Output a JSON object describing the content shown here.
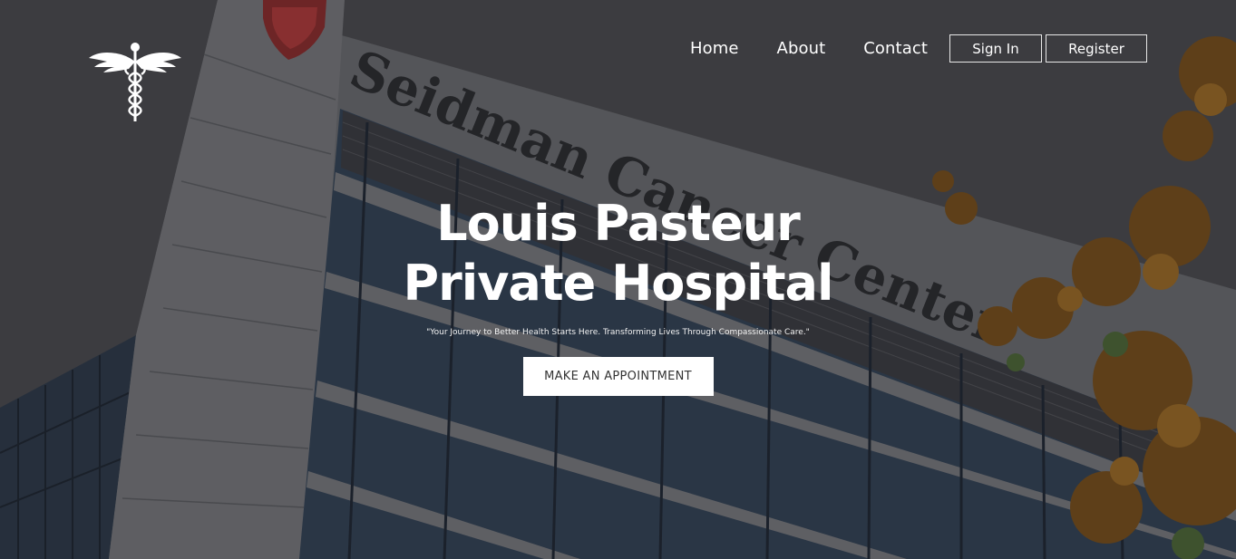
{
  "brand": {
    "logo_icon": "caduceus-icon"
  },
  "nav": {
    "home": "Home",
    "about": "About",
    "contact": "Contact",
    "sign_in": "Sign In",
    "register": "Register"
  },
  "hero": {
    "title_line1": "Louis Pasteur",
    "title_line2": "Private Hospital",
    "tagline": "\"Your Journey to Better Health Starts Here. Transforming Lives Through Compassionate Care.\"",
    "cta_label": "MAKE AN APPOINTMENT",
    "building_sign": "Seidman Cancer Center"
  },
  "colors": {
    "cta_bg": "#ffffff",
    "cta_text": "#333333",
    "text": "#ffffff",
    "foliage": "#8a5a1c"
  }
}
